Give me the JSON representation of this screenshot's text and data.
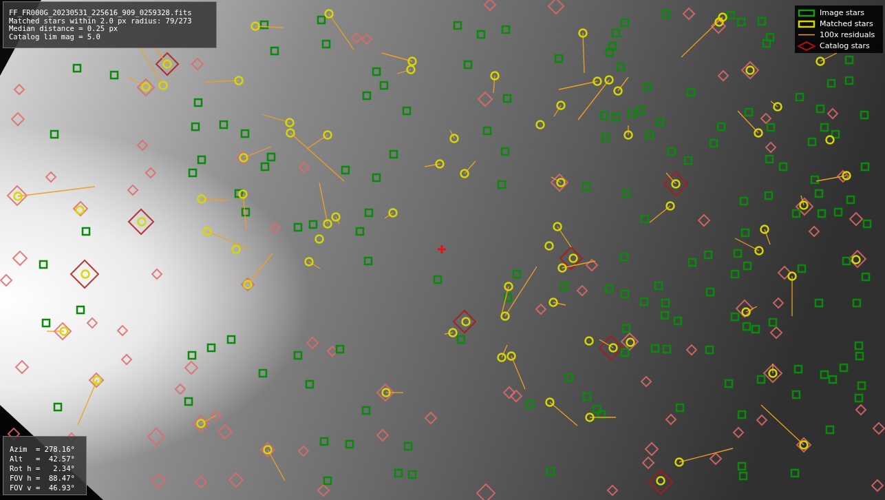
{
  "info_box": {
    "lines": [
      "FF_FR000G_20230531_225616_909_0259328.fits",
      "Matched stars within 2.0 px radius: 79/273",
      "Median distance = 0.25 px",
      "Catalog lim mag = 5.0"
    ]
  },
  "legend": {
    "items": [
      {
        "kind": "image",
        "label": "Image stars"
      },
      {
        "kind": "matched",
        "label": "Matched stars"
      },
      {
        "kind": "residual",
        "label": "100x residuals"
      },
      {
        "kind": "catalog",
        "label": "Catalog stars"
      }
    ]
  },
  "camera_box": {
    "lines": [
      "Azim  = 278.16°",
      "Alt   =  42.57°",
      "Rot h =   2.34°",
      "FOV h =  88.47°",
      "FOV v =  46.93°"
    ]
  }
}
